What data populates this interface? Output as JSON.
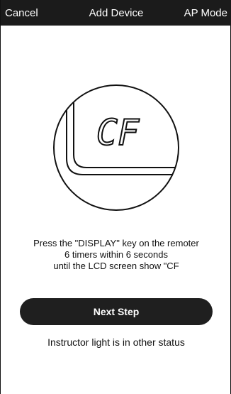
{
  "header": {
    "cancel_label": "Cancel",
    "title": "Add Device",
    "mode_label": "AP Mode"
  },
  "display": {
    "screen_text": "CF"
  },
  "instructions": {
    "lines": [
      "Press the \"DISPLAY\" key on the remoter",
      "6 timers within 6 seconds",
      "until the LCD screen show \"CF"
    ]
  },
  "actions": {
    "next_label": "Next Step",
    "other_status_label": "Instructor light is in other status"
  },
  "colors": {
    "header_bg": "#1b1b1b",
    "button_bg": "#1f1f1f",
    "text": "#111111",
    "background": "#ffffff"
  }
}
